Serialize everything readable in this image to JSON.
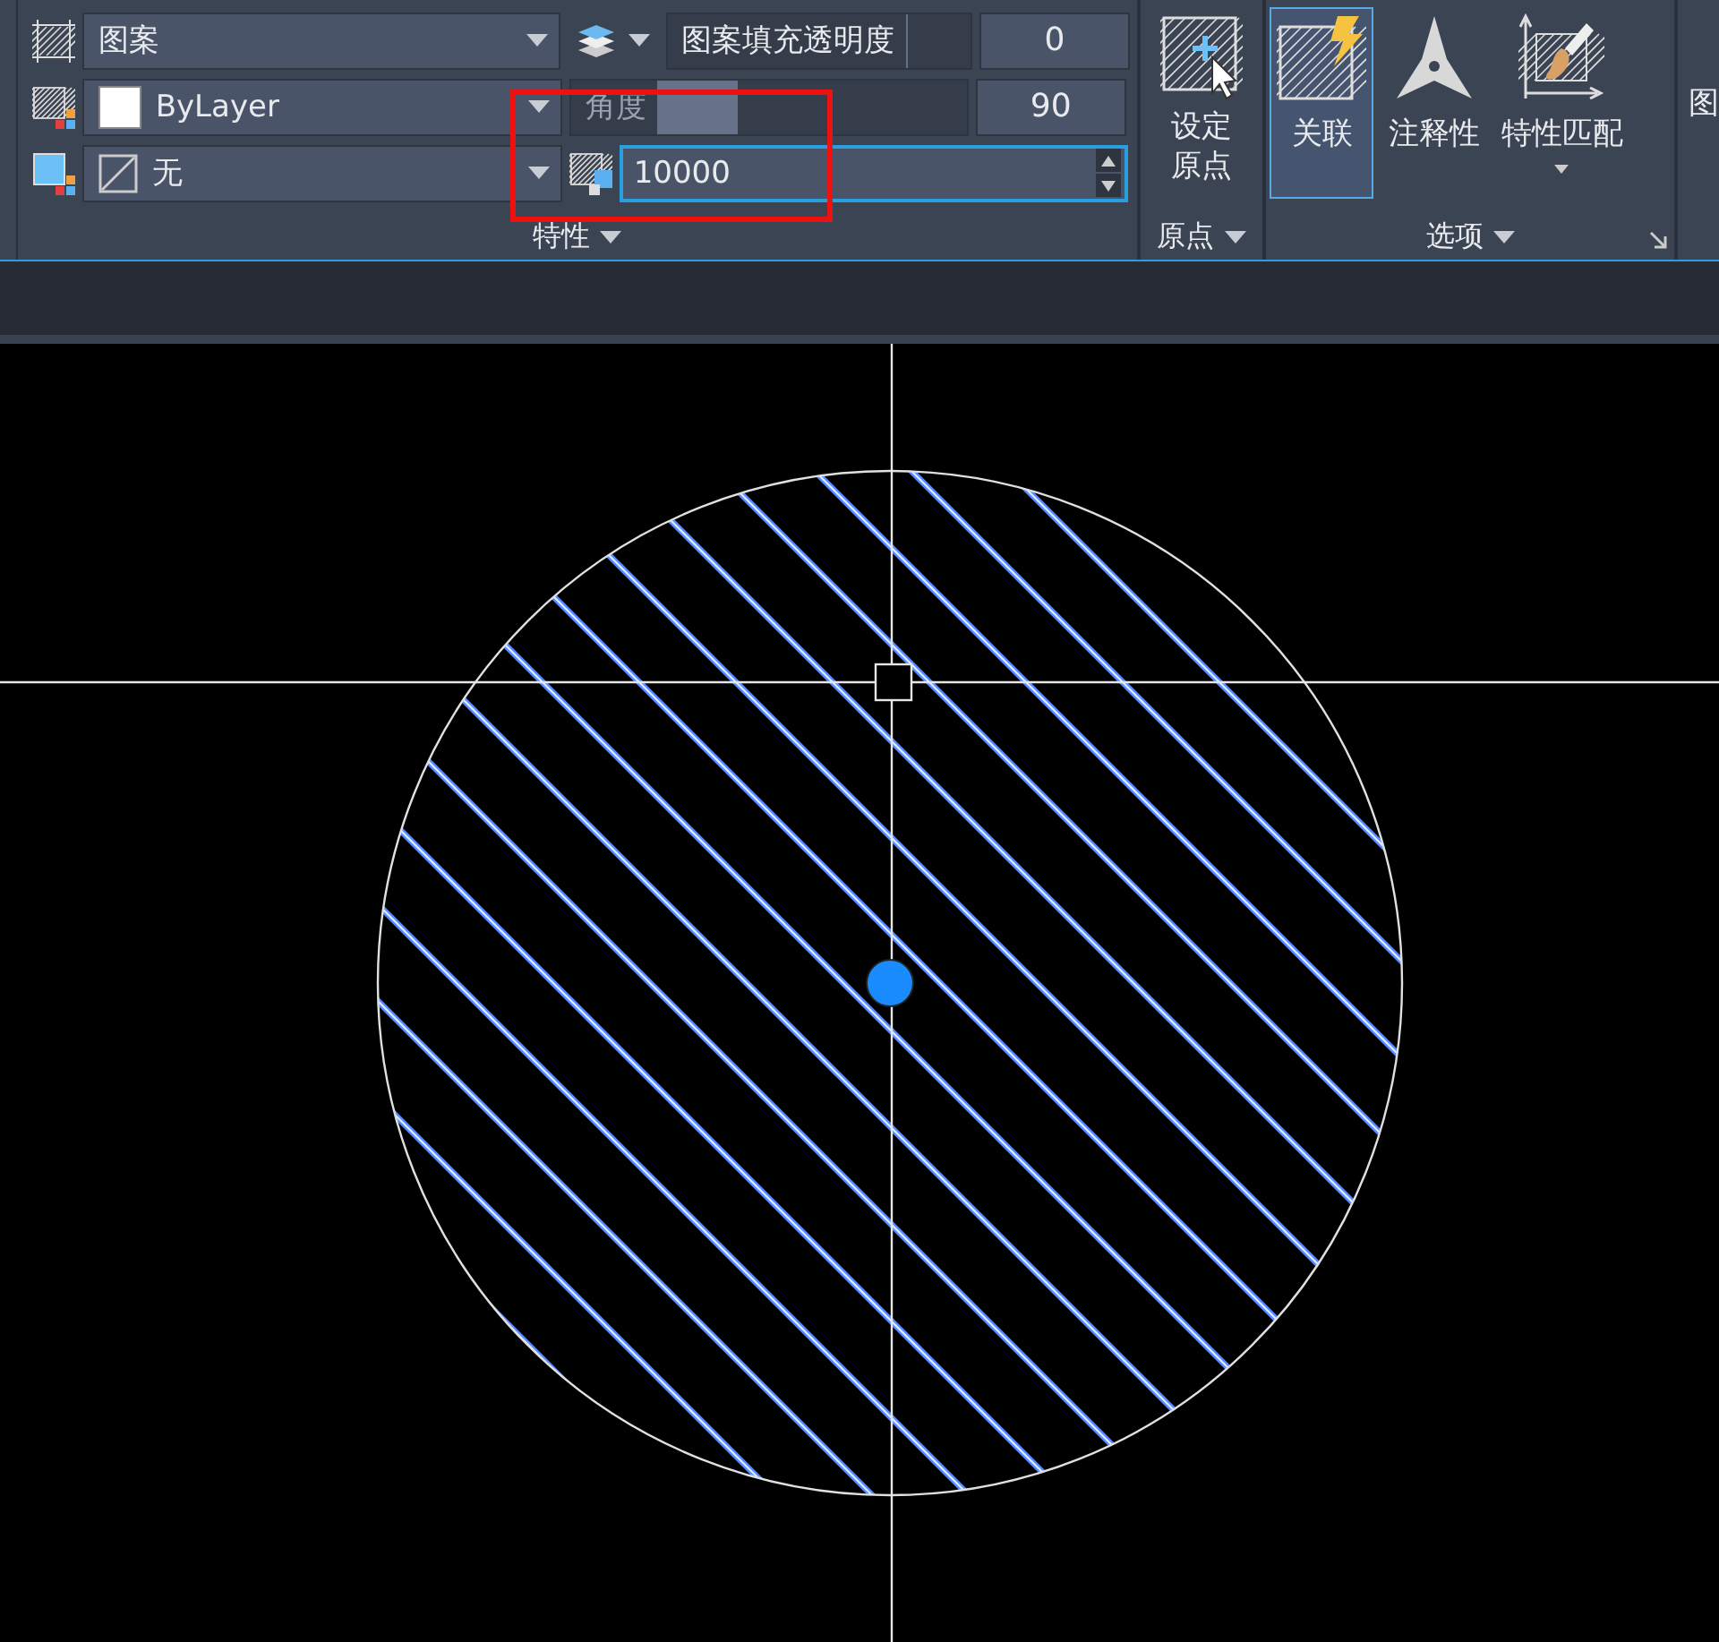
{
  "ribbon": {
    "properties_panel": {
      "title": "特性",
      "pattern_combo": {
        "value": "图案"
      },
      "color_combo": {
        "value": "ByLayer"
      },
      "background_combo": {
        "value": "无"
      },
      "transparency": {
        "label": "图案填充透明度",
        "level": 0.02,
        "value": "0"
      },
      "angle": {
        "label": "角度",
        "level": 0.26,
        "value": "90"
      },
      "scale": {
        "value": "10000",
        "focused": true
      }
    },
    "origin_panel": {
      "title": "原点",
      "button_lines": [
        "设定",
        "原点"
      ]
    },
    "options_panel": {
      "title": "选项",
      "buttons": [
        {
          "label": "关联",
          "kind": "associative",
          "selected": true,
          "dropdown": false
        },
        {
          "label": "注释性",
          "kind": "annotative",
          "selected": false,
          "dropdown": false
        },
        {
          "label": "特性匹配",
          "kind": "match",
          "selected": false,
          "dropdown": true
        }
      ]
    },
    "next_panel": {
      "label": "图"
    }
  }
}
